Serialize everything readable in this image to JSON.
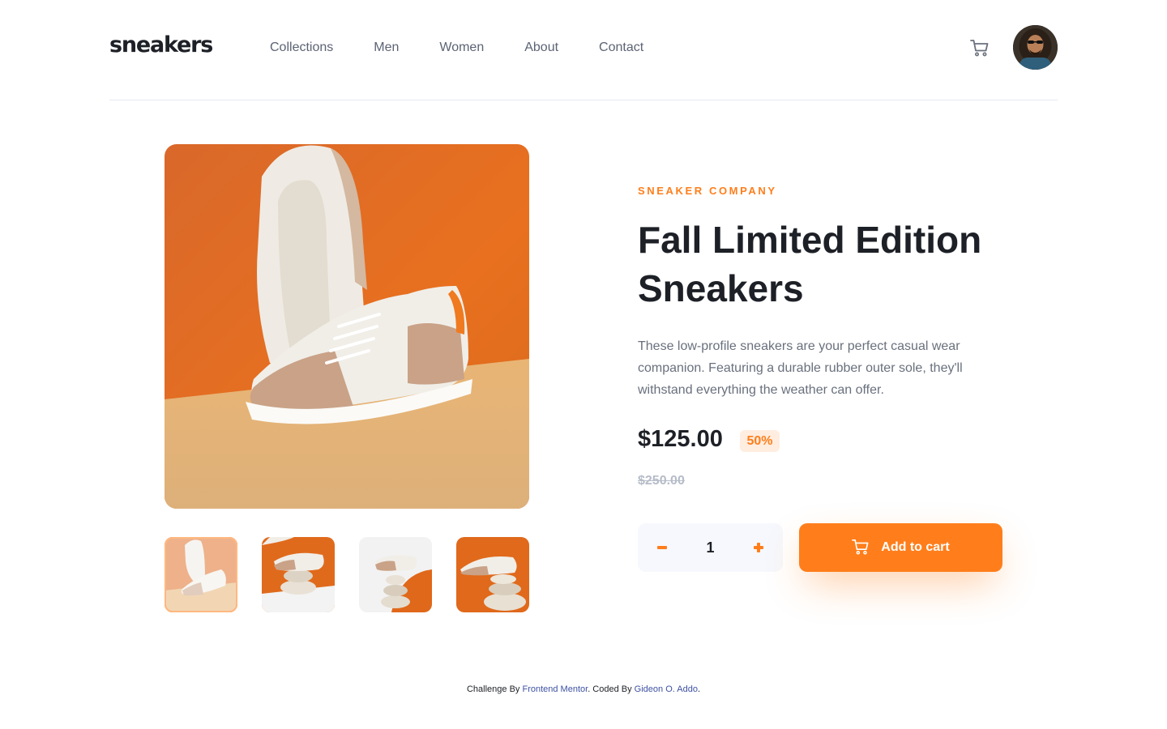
{
  "header": {
    "logo": "sneakers",
    "nav": [
      "Collections",
      "Men",
      "Women",
      "About",
      "Contact"
    ],
    "cart_icon": "cart-icon",
    "avatar": "user-avatar"
  },
  "product": {
    "company": "SNEAKER COMPANY",
    "title_line1": "Fall Limited Edition",
    "title_line2": "Sneakers",
    "description": "These low-profile sneakers are your perfect casual wear companion. Featuring a durable rubber outer sole, they'll withstand everything the weather can offer.",
    "price": "$125.00",
    "discount": "50%",
    "old_price": "$250.00",
    "quantity": "1",
    "add_to_cart": "Add to cart",
    "active_thumbnail": 1
  },
  "footer": {
    "prefix": "Challenge By",
    "link1": "Frontend Mentor",
    "middle": ". Coded By",
    "link2": "Gideon O. Addo",
    "suffix": "."
  },
  "colors": {
    "accent": "#ff7e1b",
    "accent_pale": "#ffede0",
    "text_dark": "#1d2026",
    "text_gray": "#69707d",
    "link": "#3e52a3"
  }
}
